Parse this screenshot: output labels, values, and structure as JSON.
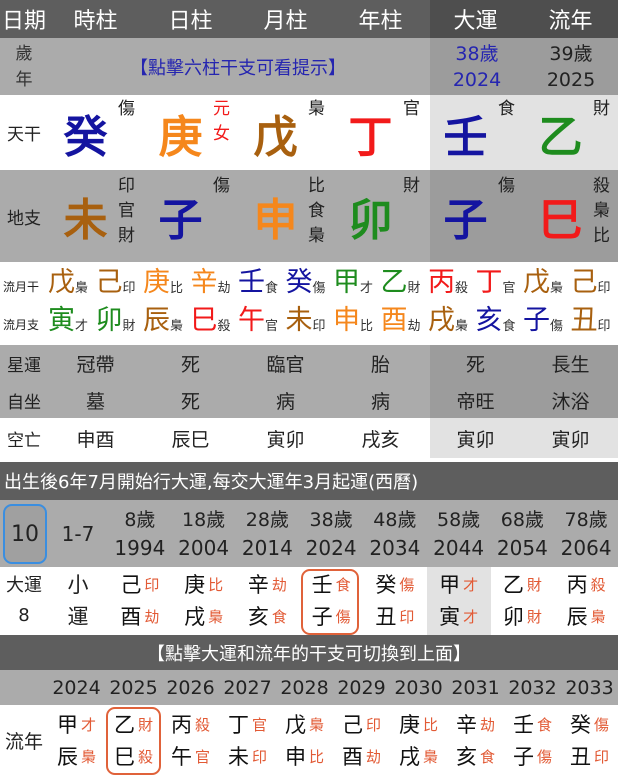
{
  "header": {
    "columns": [
      "日期",
      "時柱",
      "日柱",
      "月柱",
      "年柱",
      "大運",
      "流年"
    ]
  },
  "age_row": {
    "label_top": "歲",
    "label_bottom": "年",
    "hint": "【點擊六柱干支可看提示】",
    "dayun_age": "38歲",
    "dayun_year": "2024",
    "liunian_age": "39歲",
    "liunian_year": "2025"
  },
  "colors": {
    "blue": "#1414a0",
    "orange": "#f5871c",
    "brown": "#a8600f",
    "red": "#f21a1a",
    "green": "#1e8c1e",
    "hint": "#2525b0"
  },
  "stems": {
    "label": "天干",
    "items": [
      {
        "char": "癸",
        "color": "blue",
        "tags": [
          "傷"
        ]
      },
      {
        "char": "庚",
        "color": "orange",
        "tags": [
          "元",
          "女"
        ],
        "tag_color": "red"
      },
      {
        "char": "戊",
        "color": "brown",
        "tags": [
          "梟"
        ]
      },
      {
        "char": "丁",
        "color": "red",
        "tags": [
          "官"
        ]
      },
      {
        "char": "壬",
        "color": "blue",
        "tags": [
          "食"
        ]
      },
      {
        "char": "乙",
        "color": "green",
        "tags": [
          "財"
        ]
      }
    ]
  },
  "branches": {
    "label": "地支",
    "items": [
      {
        "char": "未",
        "color": "brown",
        "tags": [
          "印",
          "官",
          "財"
        ]
      },
      {
        "char": "子",
        "color": "blue",
        "tags": [
          "傷"
        ]
      },
      {
        "char": "申",
        "color": "orange",
        "tags": [
          "比",
          "食",
          "梟"
        ]
      },
      {
        "char": "卯",
        "color": "green",
        "tags": [
          "財"
        ]
      },
      {
        "char": "子",
        "color": "blue",
        "tags": [
          "傷"
        ]
      },
      {
        "char": "巳",
        "color": "red",
        "tags": [
          "殺",
          "梟",
          "比"
        ]
      }
    ]
  },
  "liuyue": {
    "gan_label": "流月干",
    "gan": [
      [
        "戊",
        "brown",
        "梟"
      ],
      [
        "己",
        "brown",
        "印"
      ],
      [
        "庚",
        "orange",
        "比"
      ],
      [
        "辛",
        "orange",
        "劫"
      ],
      [
        "壬",
        "blue",
        "食"
      ],
      [
        "癸",
        "blue",
        "傷"
      ],
      [
        "甲",
        "green",
        "才"
      ],
      [
        "乙",
        "green",
        "財"
      ],
      [
        "丙",
        "red",
        "殺"
      ],
      [
        "丁",
        "red",
        "官"
      ],
      [
        "戊",
        "brown",
        "梟"
      ],
      [
        "己",
        "brown",
        "印"
      ]
    ],
    "zhi_label": "流月支",
    "zhi": [
      [
        "寅",
        "green",
        "才"
      ],
      [
        "卯",
        "green",
        "財"
      ],
      [
        "辰",
        "brown",
        "梟"
      ],
      [
        "巳",
        "red",
        "殺"
      ],
      [
        "午",
        "red",
        "官"
      ],
      [
        "未",
        "brown",
        "印"
      ],
      [
        "申",
        "orange",
        "比"
      ],
      [
        "酉",
        "orange",
        "劫"
      ],
      [
        "戌",
        "brown",
        "梟"
      ],
      [
        "亥",
        "blue",
        "食"
      ],
      [
        "子",
        "blue",
        "傷"
      ],
      [
        "丑",
        "brown",
        "印"
      ]
    ]
  },
  "xingyun": {
    "label": "星運",
    "values": [
      "冠帶",
      "死",
      "臨官",
      "胎",
      "死",
      "長生"
    ]
  },
  "zizuo": {
    "label": "自坐",
    "values": [
      "墓",
      "死",
      "病",
      "病",
      "帝旺",
      "沐浴"
    ]
  },
  "kongwang": {
    "label": "空亡",
    "values": [
      "申酉",
      "辰巳",
      "寅卯",
      "戌亥",
      "寅卯",
      "寅卯"
    ]
  },
  "dayun": {
    "banner": "出生後6年7月開始行大運,每交大運年3月起運(西曆)",
    "selected": "10",
    "xiao_range": "1-7",
    "columns": [
      [
        "8歲",
        "1994"
      ],
      [
        "18歲",
        "2004"
      ],
      [
        "28歲",
        "2014"
      ],
      [
        "38歲",
        "2024"
      ],
      [
        "48歲",
        "2034"
      ],
      [
        "58歲",
        "2044"
      ],
      [
        "68歲",
        "2054"
      ],
      [
        "78歲",
        "2064"
      ]
    ],
    "row_label": "大運",
    "row_number": "8",
    "xiao_top": "小",
    "xiao_bottom": "運",
    "items": [
      [
        "己",
        "印",
        "酉",
        "劫"
      ],
      [
        "庚",
        "比",
        "戌",
        "梟"
      ],
      [
        "辛",
        "劫",
        "亥",
        "食"
      ],
      [
        "壬",
        "食",
        "子",
        "傷"
      ],
      [
        "癸",
        "傷",
        "丑",
        "印"
      ],
      [
        "甲",
        "才",
        "寅",
        "才"
      ],
      [
        "乙",
        "財",
        "卯",
        "財"
      ],
      [
        "丙",
        "殺",
        "辰",
        "梟"
      ]
    ],
    "current_index": 3,
    "shaded_index": 5
  },
  "liunian": {
    "banner": "【點擊大運和流年的干支可切換到上面】",
    "label": "流年",
    "years": [
      "2024",
      "2025",
      "2026",
      "2027",
      "2028",
      "2029",
      "2030",
      "2031",
      "2032",
      "2033"
    ],
    "items": [
      [
        "甲",
        "才",
        "辰",
        "梟"
      ],
      [
        "乙",
        "財",
        "巳",
        "殺"
      ],
      [
        "丙",
        "殺",
        "午",
        "官"
      ],
      [
        "丁",
        "官",
        "未",
        "印"
      ],
      [
        "戊",
        "梟",
        "申",
        "比"
      ],
      [
        "己",
        "印",
        "酉",
        "劫"
      ],
      [
        "庚",
        "比",
        "戌",
        "梟"
      ],
      [
        "辛",
        "劫",
        "亥",
        "食"
      ],
      [
        "壬",
        "食",
        "子",
        "傷"
      ],
      [
        "癸",
        "傷",
        "丑",
        "印"
      ]
    ],
    "current_index": 1
  }
}
